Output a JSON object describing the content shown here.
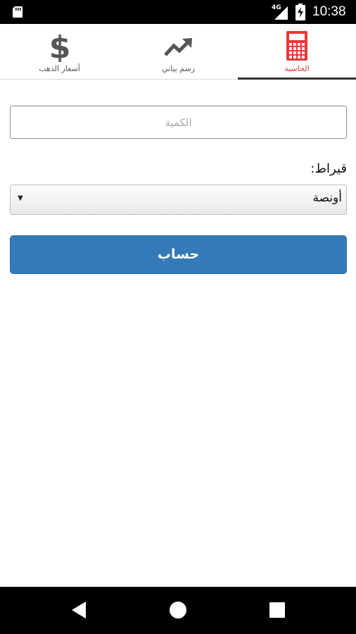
{
  "status_bar": {
    "time": "10:38",
    "network": "4G",
    "icons": [
      "sd-card-icon",
      "signal-icon",
      "battery-charging-icon"
    ]
  },
  "tabs": [
    {
      "label": "أسعار الذهب",
      "icon": "dollar-icon",
      "active": false
    },
    {
      "label": "رسم بياني",
      "icon": "trending-up-icon",
      "active": false
    },
    {
      "label": "الحاسبة",
      "icon": "calculator-icon",
      "active": true
    }
  ],
  "form": {
    "quantity_placeholder": "الكمية",
    "quantity_value": "",
    "karat_label": "قيراط:",
    "karat_selected": "أونصة",
    "calculate_label": "حساب"
  },
  "colors": {
    "accent_active_tab": "#e53935",
    "button": "#337ab7"
  },
  "nav_bar": {
    "icons": [
      "back-icon",
      "home-icon",
      "recent-apps-icon"
    ]
  }
}
